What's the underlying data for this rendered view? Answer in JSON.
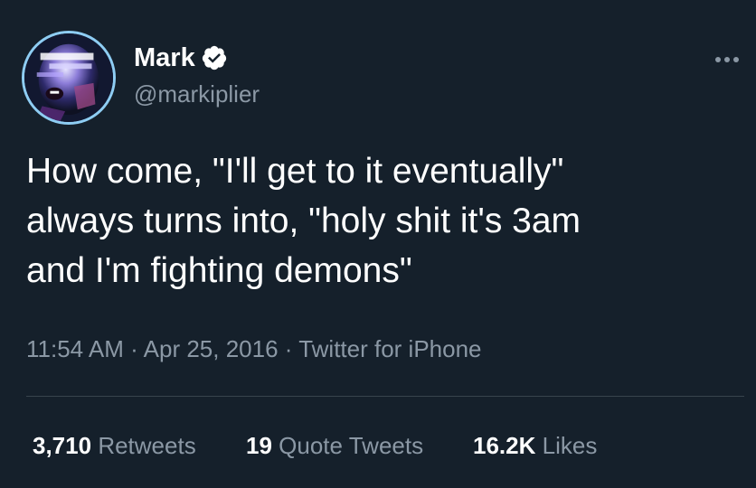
{
  "author": {
    "display_name": "Mark",
    "handle": "@markiplier",
    "verified": true,
    "avatar_icon": "avatar-image",
    "verified_icon": "verified-badge-icon"
  },
  "tweet": {
    "text": "How come, \"I'll get to it eventually\"\nalways turns into, \"holy shit it's 3am\nand I'm fighting demons\"",
    "time": "11:54 AM",
    "separator": "·",
    "date": "Apr 25, 2016",
    "source": "Twitter for iPhone"
  },
  "stats": {
    "retweets": {
      "count": "3,710",
      "label": "Retweets"
    },
    "quotes": {
      "count": "19",
      "label": "Quote Tweets"
    },
    "likes": {
      "count": "16.2K",
      "label": "Likes"
    }
  },
  "colors": {
    "background": "#15202b",
    "primary_text": "#ffffff",
    "secondary_text": "#8b98a5",
    "accent": "#1d9bf0",
    "divider": "#38444d"
  },
  "more_icon": "more-horizontal-icon"
}
